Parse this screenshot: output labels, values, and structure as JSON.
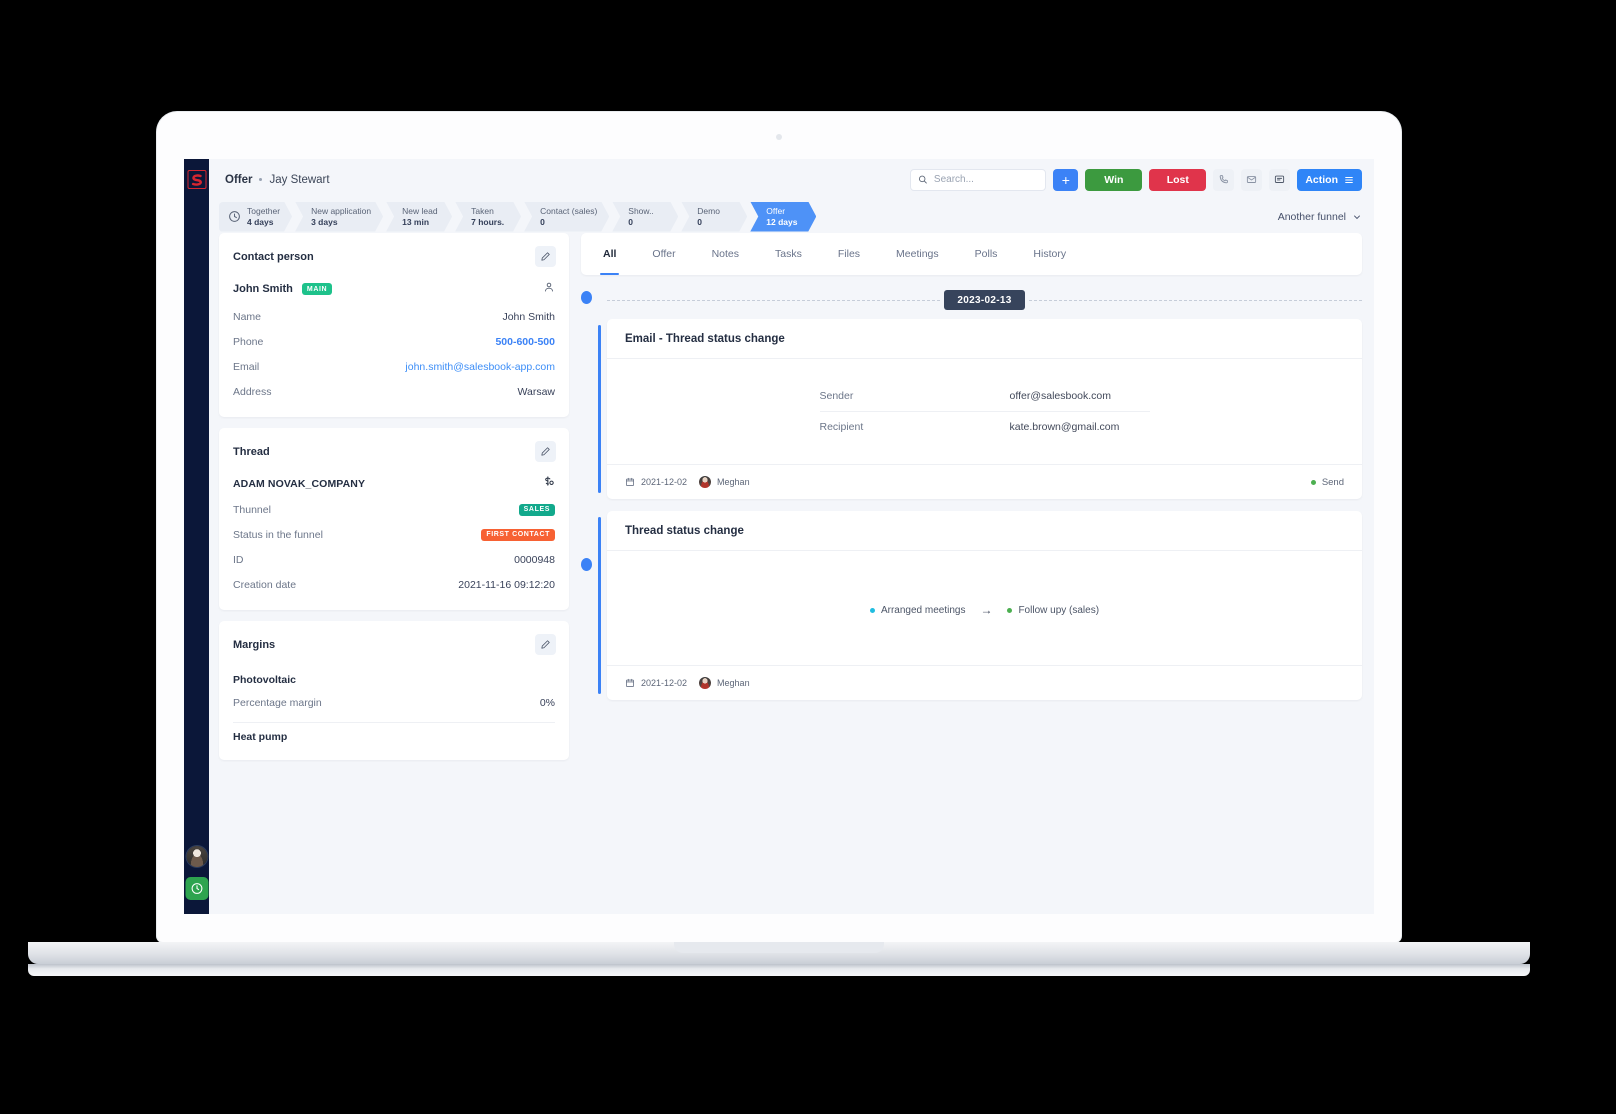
{
  "colors": {
    "accent": "#3b82f6",
    "win": "#3c9a3f",
    "lost": "#e0344b",
    "rail": "#0b1739",
    "badge_main": "#1ec28b",
    "badge_sales": "#12a98c",
    "badge_first": "#f76133",
    "date_pill": "#37445c",
    "send_dot": "#4caf50",
    "from_dot": "#21bde0",
    "to_dot": "#4caf50"
  },
  "rail": {
    "logo": "salesbook-logo-icon",
    "avatar": "user-avatar",
    "clock": "clock-icon"
  },
  "topbar": {
    "breadcrumb_primary": "Offer",
    "breadcrumb_separator": "•",
    "breadcrumb_secondary": "Jay Stewart",
    "search_placeholder": "Search...",
    "search_value": "",
    "add_label": "+",
    "win_label": "Win",
    "lost_label": "Lost",
    "phone_icon": "phone-icon",
    "mail_icon": "mail-icon",
    "chat_icon": "chat-icon",
    "action_label": "Action"
  },
  "funnel": {
    "steps": [
      {
        "label": "Together",
        "value": "4 days",
        "active": false,
        "icon": "clock-icon"
      },
      {
        "label": "New application",
        "value": "3 days",
        "active": false
      },
      {
        "label": "New lead",
        "value": "13 min",
        "active": false
      },
      {
        "label": "Taken",
        "value": "7 hours.",
        "active": false
      },
      {
        "label": "Contact (sales)",
        "value": "0",
        "active": false
      },
      {
        "label": "Show..",
        "value": "0",
        "active": false
      },
      {
        "label": "Demo",
        "value": "0",
        "active": false
      },
      {
        "label": "Offer",
        "value": "12 days",
        "active": true
      }
    ],
    "selector_label": "Another funnel"
  },
  "contact_card": {
    "title": "Contact person",
    "edit_icon": "pencil-icon",
    "person_name": "John Smith",
    "person_badge": "MAIN",
    "person_icon": "person-icon",
    "rows": [
      {
        "key": "Name",
        "value": "John Smith",
        "style": "plain"
      },
      {
        "key": "Phone",
        "value": "500-600-500",
        "style": "link"
      },
      {
        "key": "Email",
        "value": "john.smith@salesbook-app.com",
        "style": "mail"
      },
      {
        "key": "Address",
        "value": "Warsaw",
        "style": "plain"
      }
    ]
  },
  "thread_card": {
    "title": "Thread",
    "edit_icon": "pencil-icon",
    "company": "ADAM NOVAK_COMPANY",
    "money_icon": "money-icon",
    "rows": [
      {
        "key": "Thunnel",
        "value": "SALES",
        "style": "badge-sales"
      },
      {
        "key": "Status in the funnel",
        "value": "FIRST CONTACT",
        "style": "badge-first"
      },
      {
        "key": "ID",
        "value": "0000948",
        "style": "plain"
      },
      {
        "key": "Creation date",
        "value": "2021-11-16 09:12:20",
        "style": "plain"
      }
    ]
  },
  "margins_card": {
    "title": "Margins",
    "edit_icon": "pencil-icon",
    "section_1": "Photovoltaic",
    "row_1_key": "Percentage margin",
    "row_1_value": "0%",
    "section_2": "Heat pump"
  },
  "tabs": [
    {
      "label": "All",
      "active": true
    },
    {
      "label": "Offer",
      "active": false
    },
    {
      "label": "Notes",
      "active": false
    },
    {
      "label": "Tasks",
      "active": false
    },
    {
      "label": "Files",
      "active": false
    },
    {
      "label": "Meetings",
      "active": false
    },
    {
      "label": "Polls",
      "active": false
    },
    {
      "label": "History",
      "active": false
    }
  ],
  "timeline": {
    "date_pill": "2023-02-13",
    "event_1": {
      "title": "Email - Thread status change",
      "rows": [
        {
          "key": "Sender",
          "value": "offer@salesbook.com"
        },
        {
          "key": "Recipient",
          "value": "kate.brown@gmail.com"
        }
      ],
      "footer_date": "2021-12-02",
      "footer_user": "Meghan",
      "footer_status": "Send",
      "calendar_icon": "calendar-icon"
    },
    "event_2": {
      "title": "Thread status change",
      "from_status": "Arranged meetings",
      "arrow": "→",
      "to_status": "Follow upy (sales)",
      "footer_date": "2021-12-02",
      "footer_user": "Meghan",
      "calendar_icon": "calendar-icon"
    }
  }
}
